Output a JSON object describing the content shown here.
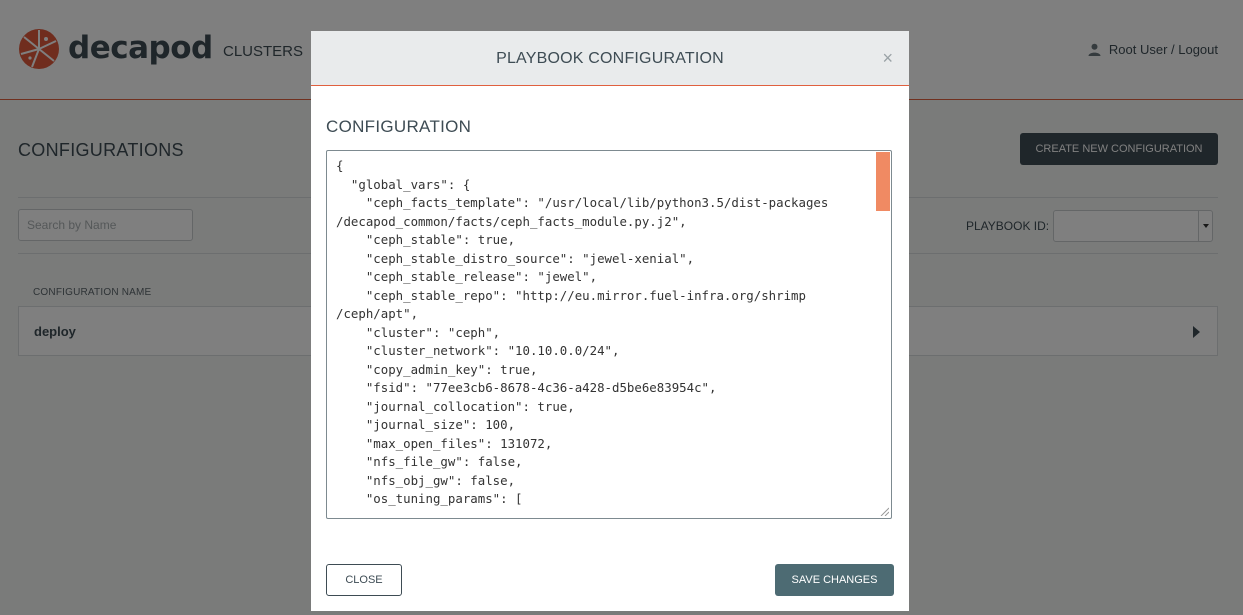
{
  "app": {
    "brand": "decapod",
    "nav_clusters": "CLUSTERS",
    "user_text": "Root User / Logout"
  },
  "page": {
    "title": "CONFIGURATIONS",
    "create_button": "CREATE NEW CONFIGURATION",
    "search_placeholder": "Search by Name",
    "playbook_id_label": "PLAYBOOK ID:",
    "column_header": "CONFIGURATION NAME",
    "rows": [
      {
        "name": "deploy"
      }
    ]
  },
  "modal": {
    "title": "PLAYBOOK CONFIGURATION",
    "close_symbol": "×",
    "section_title": "CONFIGURATION",
    "close_button": "CLOSE",
    "save_button": "SAVE CHANGES",
    "code_lines": [
      "{",
      "  \"global_vars\": {",
      "    \"ceph_facts_template\": \"/usr/local/lib/python3.5/dist-packages",
      "/decapod_common/facts/ceph_facts_module.py.j2\",",
      "    \"ceph_stable\": true,",
      "    \"ceph_stable_distro_source\": \"jewel-xenial\",",
      "    \"ceph_stable_release\": \"jewel\",",
      "    \"ceph_stable_repo\": \"http://eu.mirror.fuel-infra.org/shrimp",
      "/ceph/apt\",",
      "    \"cluster\": \"ceph\",",
      "    \"cluster_network\": \"10.10.0.0/24\",",
      "    \"copy_admin_key\": true,",
      "    \"fsid\": \"77ee3cb6-8678-4c36-a428-d5be6e83954c\",",
      "    \"journal_collocation\": true,",
      "    \"journal_size\": 100,",
      "    \"max_open_files\": 131072,",
      "    \"nfs_file_gw\": false,",
      "    \"nfs_obj_gw\": false,",
      "    \"os_tuning_params\": ["
    ]
  }
}
